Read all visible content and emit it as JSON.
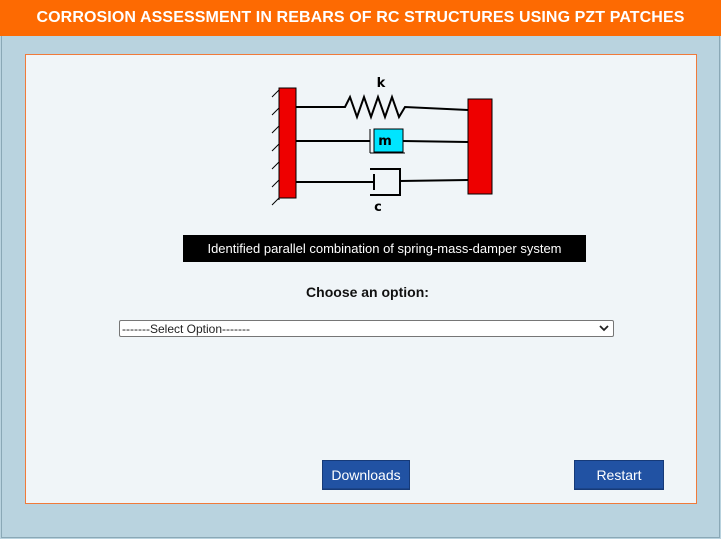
{
  "header": {
    "title": "CORROSION ASSESSMENT IN REBARS OF RC STRUCTURES USING PZT PATCHES"
  },
  "diagram": {
    "spring_label": "k",
    "mass_label": "m",
    "damper_label": "c",
    "wall_color": "#ee0000",
    "mass_color": "#00e5ff"
  },
  "main": {
    "caption": "Identified parallel combination of spring-mass-damper system",
    "choose_label": "Choose an option:",
    "select": {
      "selected": "-------Select Option-------"
    }
  },
  "buttons": {
    "downloads": "Downloads",
    "restart": "Restart"
  },
  "colors": {
    "header_bg": "#fd6a02",
    "page_bg": "#b9d3df",
    "panel_bg": "#f0f5f8",
    "button_bg": "#2152a3"
  }
}
